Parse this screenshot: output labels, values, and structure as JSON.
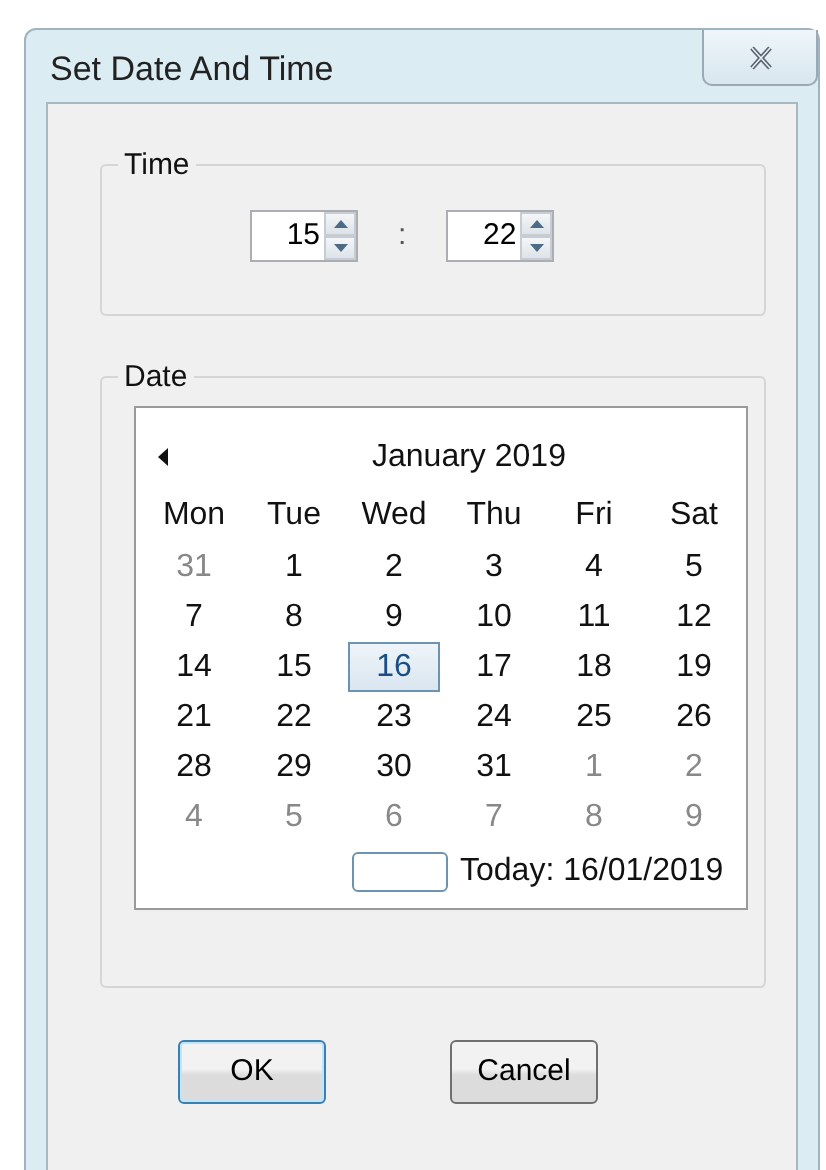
{
  "window": {
    "title": "Set Date And Time"
  },
  "time": {
    "label": "Time",
    "hours": "15",
    "separator": ":",
    "minutes": "22"
  },
  "date": {
    "label": "Date",
    "calendar": {
      "month": "January 2019",
      "weekdays": [
        "Mon",
        "Tue",
        "Wed",
        "Thu",
        "Fri",
        "Sat"
      ],
      "weeks": [
        [
          {
            "day": "31",
            "other_month": true,
            "selected": false
          },
          {
            "day": "1",
            "other_month": false,
            "selected": false
          },
          {
            "day": "2",
            "other_month": false,
            "selected": false
          },
          {
            "day": "3",
            "other_month": false,
            "selected": false
          },
          {
            "day": "4",
            "other_month": false,
            "selected": false
          },
          {
            "day": "5",
            "other_month": false,
            "selected": false
          }
        ],
        [
          {
            "day": "7",
            "other_month": false,
            "selected": false
          },
          {
            "day": "8",
            "other_month": false,
            "selected": false
          },
          {
            "day": "9",
            "other_month": false,
            "selected": false
          },
          {
            "day": "10",
            "other_month": false,
            "selected": false
          },
          {
            "day": "11",
            "other_month": false,
            "selected": false
          },
          {
            "day": "12",
            "other_month": false,
            "selected": false
          }
        ],
        [
          {
            "day": "14",
            "other_month": false,
            "selected": false
          },
          {
            "day": "15",
            "other_month": false,
            "selected": false
          },
          {
            "day": "16",
            "other_month": false,
            "selected": true
          },
          {
            "day": "17",
            "other_month": false,
            "selected": false
          },
          {
            "day": "18",
            "other_month": false,
            "selected": false
          },
          {
            "day": "19",
            "other_month": false,
            "selected": false
          }
        ],
        [
          {
            "day": "21",
            "other_month": false,
            "selected": false
          },
          {
            "day": "22",
            "other_month": false,
            "selected": false
          },
          {
            "day": "23",
            "other_month": false,
            "selected": false
          },
          {
            "day": "24",
            "other_month": false,
            "selected": false
          },
          {
            "day": "25",
            "other_month": false,
            "selected": false
          },
          {
            "day": "26",
            "other_month": false,
            "selected": false
          }
        ],
        [
          {
            "day": "28",
            "other_month": false,
            "selected": false
          },
          {
            "day": "29",
            "other_month": false,
            "selected": false
          },
          {
            "day": "30",
            "other_month": false,
            "selected": false
          },
          {
            "day": "31",
            "other_month": false,
            "selected": false
          },
          {
            "day": "1",
            "other_month": true,
            "selected": false
          },
          {
            "day": "2",
            "other_month": true,
            "selected": false
          }
        ],
        [
          {
            "day": "4",
            "other_month": true,
            "selected": false
          },
          {
            "day": "5",
            "other_month": true,
            "selected": false
          },
          {
            "day": "6",
            "other_month": true,
            "selected": false
          },
          {
            "day": "7",
            "other_month": true,
            "selected": false
          },
          {
            "day": "8",
            "other_month": true,
            "selected": false
          },
          {
            "day": "9",
            "other_month": true,
            "selected": false
          }
        ]
      ],
      "today": "Today: 16/01/2019"
    }
  },
  "buttons": [
    {
      "label": "OK",
      "default": true
    },
    {
      "label": "Cancel",
      "default": false
    }
  ]
}
